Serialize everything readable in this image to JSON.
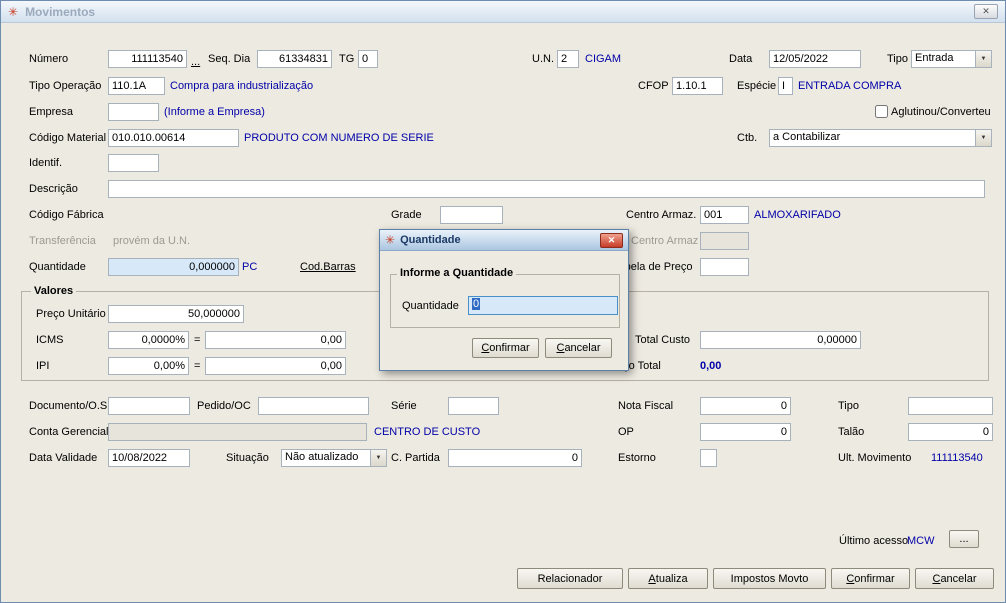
{
  "window": {
    "title": "Movimentos"
  },
  "icons": {
    "app": "✳",
    "close": "✕",
    "dropdown_arrow": "▼"
  },
  "row1": {
    "numero_label": "Número",
    "numero_value": "111113540",
    "more_button": "...",
    "seqdia_label": "Seq. Dia",
    "seqdia_value": "61334831",
    "tg_label": "TG",
    "tg_value": "0",
    "un_label": "U.N.",
    "un_value": "2",
    "un_desc": "CIGAM",
    "data_label": "Data",
    "data_value": "12/05/2022",
    "tipo_label": "Tipo",
    "tipo_value": "Entrada"
  },
  "row2": {
    "tipo_operacao_label": "Tipo Operação",
    "tipo_operacao_value": "110.1A",
    "tipo_operacao_desc": "Compra para industrialização",
    "cfop_label": "CFOP",
    "cfop_value": "1.10.1",
    "especie_label": "Espécie",
    "especie_value": "I",
    "especie_desc": "ENTRADA COMPRA"
  },
  "row3": {
    "empresa_label": "Empresa",
    "empresa_value": "",
    "empresa_hint": "(Informe a Empresa)",
    "aglutinou_label": "Aglutinou/Converteu"
  },
  "row4": {
    "codigo_material_label": "Código Material",
    "codigo_material_value": "010.010.00614",
    "codigo_material_desc": "PRODUTO COM NUMERO DE SERIE",
    "ctb_label": "Ctb.",
    "ctb_value": "a Contabilizar"
  },
  "row5": {
    "identif_label": "Identif.",
    "identif_value": ""
  },
  "row6": {
    "descricao_label": "Descrição",
    "descricao_value": ""
  },
  "row7": {
    "codigo_fabrica_label": "Código Fábrica",
    "grade_label": "Grade",
    "grade_value": "",
    "centro_armaz_label": "Centro Armaz.",
    "centro_armaz_value": "001",
    "centro_armaz_desc": "ALMOXARIFADO"
  },
  "row8": {
    "transferencia_label": "Transferência",
    "transferencia_desc": "provém da U.N.",
    "centro_armaz2_label": "Centro Armaz",
    "centro_armaz2_value": ""
  },
  "row9": {
    "quantidade_label": "Quantidade",
    "quantidade_value": "0,000000",
    "quantidade_unit": "PC",
    "cod_barras_link": "Cod.Barras",
    "tabela_preco_label": "Tabela de Preço",
    "tabela_preco_value": ""
  },
  "valores": {
    "group_label": "Valores",
    "preco_unitario_label": "Preço Unitário",
    "preco_unitario_value": "50,000000",
    "icms_label": "ICMS",
    "icms_pct": "0,0000%",
    "equals": "=",
    "icms_value": "0,00",
    "ipi_label": "IPI",
    "ipi_pct": "0,00%",
    "ipi_value": "0,00",
    "total_custo_label": "Total Custo",
    "total_custo_value": "0,00000",
    "preco_total_label": "Preço Total",
    "preco_total_value": "0,00"
  },
  "row10": {
    "documento_label": "Documento/O.S",
    "documento_value": "",
    "pedido_label": "Pedido/OC",
    "pedido_value": "",
    "serie_label": "Série",
    "serie_value": "",
    "nota_fiscal_label": "Nota Fiscal",
    "nota_fiscal_value": "0",
    "tipo2_label": "Tipo",
    "tipo2_value": ""
  },
  "row11": {
    "conta_gerencial_label": "Conta Gerencial",
    "conta_gerencial_value": "",
    "conta_gerencial_desc": "CENTRO DE CUSTO",
    "op_label": "OP",
    "op_value": "0",
    "talao_label": "Talão",
    "talao_value": "0"
  },
  "row12": {
    "data_validade_label": "Data Validade",
    "data_validade_value": "10/08/2022",
    "situacao_label": "Situação",
    "situacao_value": "Não atualizado",
    "c_partida_label": "C. Partida",
    "c_partida_value": "0",
    "estorno_label": "Estorno",
    "estorno_value": "",
    "ult_movimento_label": "Ult. Movimento",
    "ult_movimento_value": "111113540"
  },
  "footer": {
    "ultimo_acesso_label": "Último acesso",
    "ultimo_acesso_value": "MCW",
    "more_button": "...",
    "relacionador": "Relacionador",
    "atualiza": "Atualiza",
    "impostos": "Impostos Movto",
    "confirmar": "Confirmar",
    "cancelar": "Cancelar"
  },
  "dialog": {
    "title": "Quantidade",
    "group_label": "Informe a Quantidade",
    "quantidade_label": "Quantidade",
    "quantidade_value": "0",
    "confirmar": "Confirmar",
    "cancelar": "Cancelar"
  }
}
